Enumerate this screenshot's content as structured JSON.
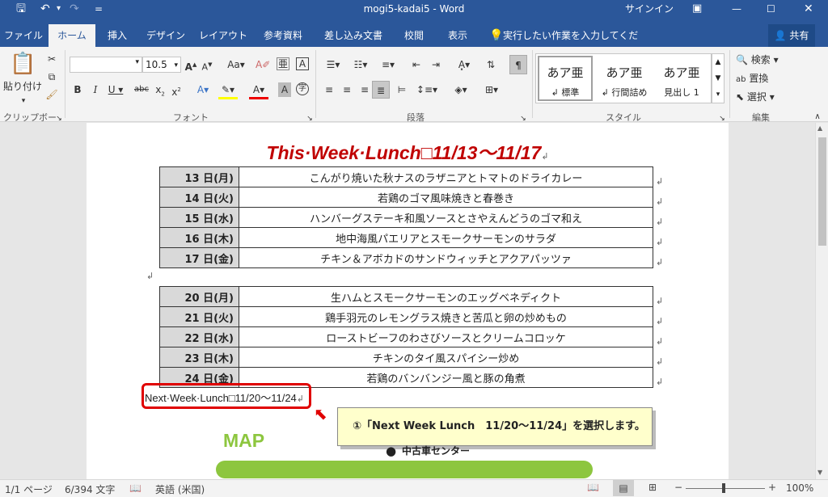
{
  "titlebar": {
    "title": "mogi5-kadai5  -  Word",
    "signin": "サインイン",
    "qat_more": "="
  },
  "tabs": [
    {
      "label": "ファイル"
    },
    {
      "label": "ホーム"
    },
    {
      "label": "挿入"
    },
    {
      "label": "デザイン"
    },
    {
      "label": "レイアウト"
    },
    {
      "label": "参考資料"
    },
    {
      "label": "差し込み文書"
    },
    {
      "label": "校閲"
    },
    {
      "label": "表示"
    }
  ],
  "tell_me": "実行したい作業を入力してください",
  "share": "共有",
  "ribbon": {
    "clipboard": {
      "paste": "貼り付け",
      "label": "クリップボード"
    },
    "font": {
      "name": "",
      "size": "10.5",
      "label": "フォント"
    },
    "paragraph": {
      "label": "段落"
    },
    "styles": {
      "label": "スタイル",
      "items": [
        {
          "preview": "あア亜",
          "name": "↲ 標準"
        },
        {
          "preview": "あア亜",
          "name": "↲ 行間詰め"
        },
        {
          "preview": "あア亜",
          "name": "見出し 1"
        }
      ]
    },
    "editing": {
      "find": "検索",
      "replace": "置換",
      "select": "選択",
      "label": "編集"
    }
  },
  "document": {
    "heading": "This·Week·Lunch□11/13～11/17",
    "week1": [
      {
        "day": "13 日(月)",
        "dish": "こんがり焼いた秋ナスのラザニアとトマトのドライカレー"
      },
      {
        "day": "14 日(火)",
        "dish": "若鶏のゴマ風味焼きと春巻き"
      },
      {
        "day": "15 日(水)",
        "dish": "ハンバーグステーキ和風ソースとさやえんどうのゴマ和え"
      },
      {
        "day": "16 日(木)",
        "dish": "地中海風パエリアとスモークサーモンのサラダ"
      },
      {
        "day": "17 日(金)",
        "dish": "チキン＆アボカドのサンドウィッチとアクアパッツァ"
      }
    ],
    "week2": [
      {
        "day": "20 日(月)",
        "dish": "生ハムとスモークサーモンのエッグベネディクト"
      },
      {
        "day": "21 日(火)",
        "dish": "鶏手羽元のレモングラス焼きと苦瓜と卵の炒めもの"
      },
      {
        "day": "22 日(水)",
        "dish": "ローストビーフのわさびソースとクリームコロッケ"
      },
      {
        "day": "23 日(木)",
        "dish": "チキンのタイ風スパイシー炒め"
      },
      {
        "day": "24 日(金)",
        "dish": "若鶏のバンバンジー風と豚の角煮"
      }
    ],
    "next_week": "Next·Week·Lunch□11/20～11/24",
    "callout": "①「Next Week Lunch　11/20～11/24」を選択します。",
    "map_title": "MAP",
    "map_label": "中古車センター"
  },
  "status": {
    "page": "1/1 ページ",
    "words": "6/394 文字",
    "lang": "英語 (米国)",
    "zoom": "100%"
  },
  "colors": {
    "word_blue": "#2b579a",
    "heading_red": "#c00000",
    "callout_red": "#e00000",
    "map_green": "#8dc63f"
  }
}
